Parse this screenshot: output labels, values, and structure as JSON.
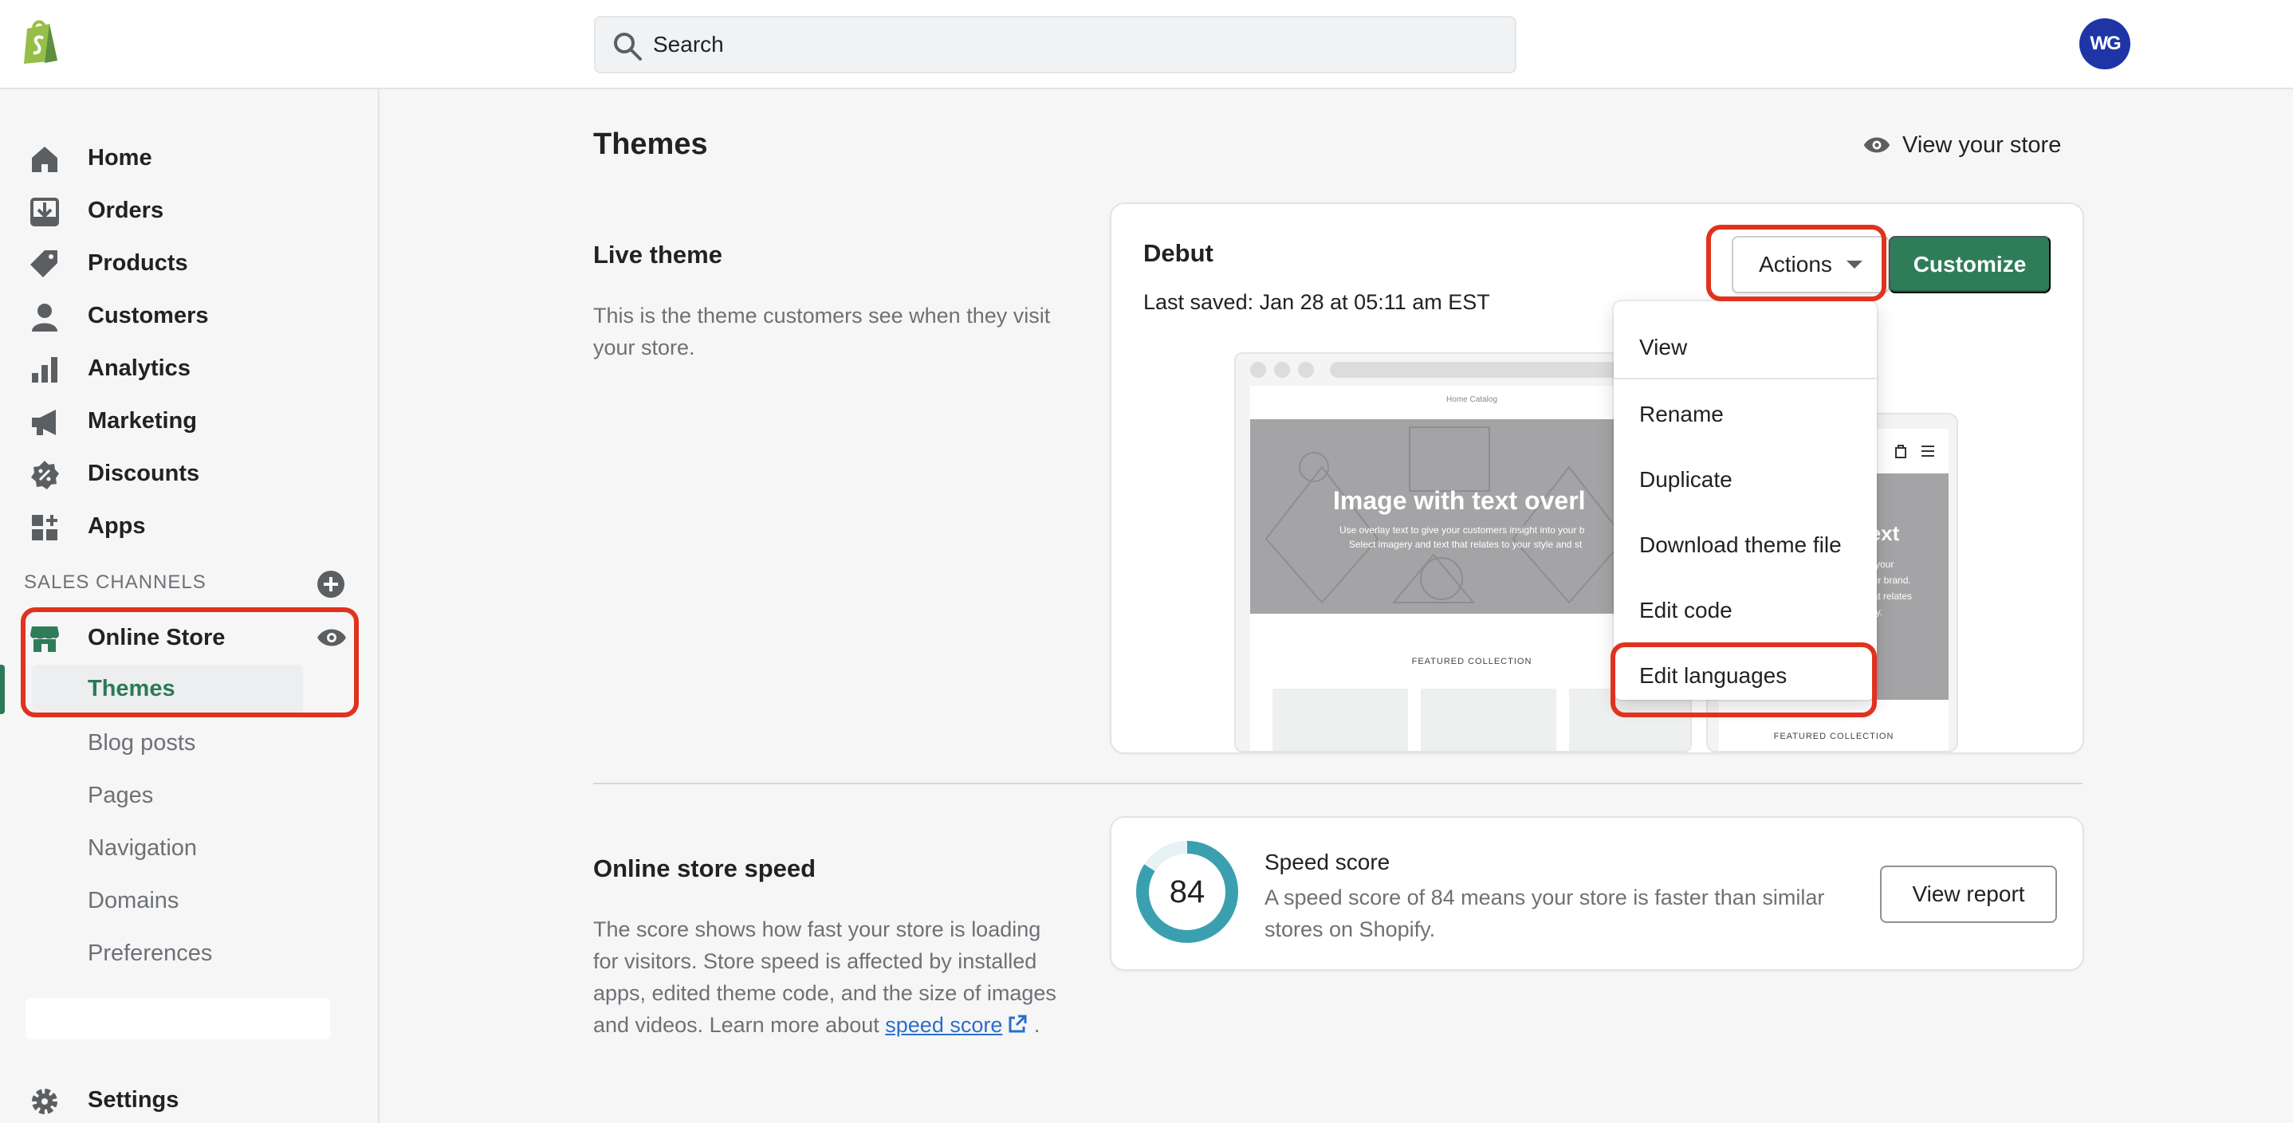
{
  "topbar": {
    "search_placeholder": "Search",
    "avatar_initials": "WG"
  },
  "sidebar": {
    "items": [
      {
        "label": "Home",
        "icon": "home-icon"
      },
      {
        "label": "Orders",
        "icon": "orders-icon"
      },
      {
        "label": "Products",
        "icon": "tag-icon"
      },
      {
        "label": "Customers",
        "icon": "person-icon"
      },
      {
        "label": "Analytics",
        "icon": "bar-chart-icon"
      },
      {
        "label": "Marketing",
        "icon": "megaphone-icon"
      },
      {
        "label": "Discounts",
        "icon": "discount-icon"
      },
      {
        "label": "Apps",
        "icon": "apps-icon"
      }
    ],
    "sales_channels_label": "SALES CHANNELS",
    "online_store": {
      "label": "Online Store",
      "sub_items": [
        "Themes",
        "Blog posts",
        "Pages",
        "Navigation",
        "Domains",
        "Preferences"
      ],
      "active": "Themes"
    },
    "settings_label": "Settings"
  },
  "main": {
    "page_title": "Themes",
    "view_store_label": "View your store",
    "live_theme": {
      "title": "Live theme",
      "description": "This is the theme customers see when they visit your store.",
      "theme_name": "Debut",
      "last_saved": "Last saved: Jan 28 at 05:11 am EST",
      "actions_label": "Actions",
      "customize_label": "Customize",
      "actions_menu": [
        "View",
        "Rename",
        "Duplicate",
        "Download theme file",
        "Edit code",
        "Edit languages"
      ],
      "preview": {
        "nav_links": "Home    Catalog",
        "hero_title": "Image with text overl",
        "hero_sub_1": "Use overlay text to give your customers insight into your b",
        "hero_sub_2": "Select imagery and text that relates to your style and st",
        "featured": "FEATURED COLLECTION",
        "mobile_title": "text",
        "mobile_sub_1": "e your",
        "mobile_sub_2": "our brand.",
        "mobile_sub_3": "hat relates",
        "mobile_sub_4": "ory.",
        "mobile_featured": "FEATURED COLLECTION"
      }
    },
    "speed": {
      "title": "Online store speed",
      "description": "The score shows how fast your store is loading for visitors. Store speed is affected by installed apps, edited theme code, and the size of images and videos. Learn more about",
      "link_label": "speed score",
      "trailing": ".",
      "score": 84,
      "score_max": 100,
      "card_title": "Speed score",
      "card_desc": "A speed score of 84 means your store is faster than similar stores on Shopify.",
      "report_label": "View report"
    }
  },
  "colors": {
    "brand_green": "#2e7d58",
    "highlight_red": "#e0321f",
    "avatar_blue": "#1f35a6",
    "gauge_teal": "#3aa0b0"
  }
}
